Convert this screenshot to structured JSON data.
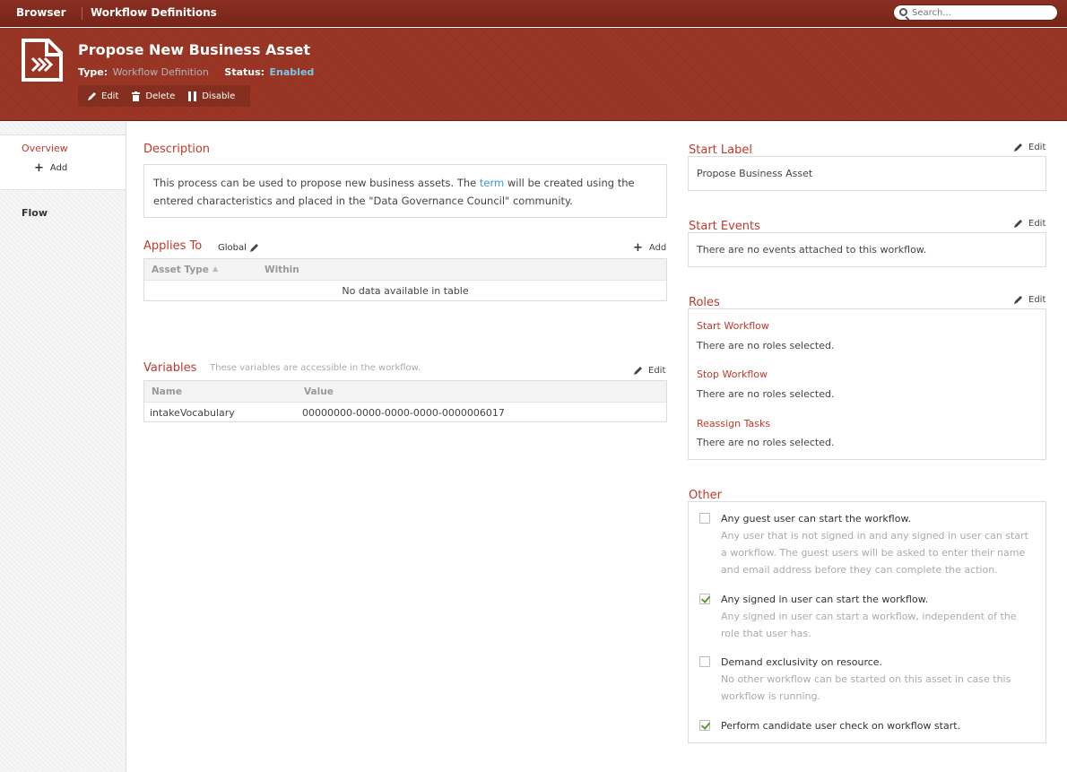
{
  "topbar": {
    "brand": "Browser",
    "crumb": "Workflow Definitions",
    "search_placeholder": "Search..."
  },
  "header": {
    "title": "Propose New Business Asset",
    "type_label": "Type:",
    "type_value": "Workflow Definition",
    "status_label": "Status:",
    "status_value": "Enabled",
    "actions": {
      "edit": "Edit",
      "delete": "Delete",
      "disable": "Disable"
    }
  },
  "sidebar": {
    "overview": "Overview",
    "add": "Add",
    "flow": "Flow"
  },
  "description": {
    "title": "Description",
    "text_before": "This process can be used to propose new business assets. The ",
    "link": "term",
    "text_after": " will be created using the entered characteristics and placed in the \"Data Governance Council\" community."
  },
  "applies_to": {
    "title": "Applies To",
    "scope": "Global",
    "add": "Add",
    "columns": [
      "Asset Type",
      "Within"
    ],
    "empty": "No data available in table"
  },
  "variables": {
    "title": "Variables",
    "note": "These variables are accessible in the workflow.",
    "edit": "Edit",
    "columns": [
      "Name",
      "Value"
    ],
    "rows": [
      {
        "name": "intakeVocabulary",
        "value": "00000000-0000-0000-0000-0000006017"
      }
    ]
  },
  "start_label": {
    "title": "Start Label",
    "edit": "Edit",
    "value": "Propose Business Asset"
  },
  "start_events": {
    "title": "Start Events",
    "edit": "Edit",
    "value": "There are no events attached to this workflow."
  },
  "roles": {
    "title": "Roles",
    "edit": "Edit",
    "items": [
      {
        "title": "Start Workflow",
        "value": "There are no roles selected."
      },
      {
        "title": "Stop Workflow",
        "value": "There are no roles selected."
      },
      {
        "title": "Reassign Tasks",
        "value": "There are no roles selected."
      }
    ]
  },
  "other": {
    "title": "Other",
    "options": [
      {
        "label": "Any guest user can start the workflow.",
        "checked": false,
        "help": "Any user that is not signed in and any signed in user can start a workflow. The guest users will be asked to enter their name and email address before they can complete the action."
      },
      {
        "label": "Any signed in user can start the workflow.",
        "checked": true,
        "help": "Any signed in user can start a workflow, independent of the role that user has."
      },
      {
        "label": "Demand exclusivity on resource.",
        "checked": false,
        "help": "No other workflow can be started on this asset in case this workflow is running."
      },
      {
        "label": "Perform candidate user check on workflow start.",
        "checked": true,
        "help": ""
      }
    ]
  },
  "colors": {
    "brand": "#8a2f23",
    "accent_red": "#c0392b",
    "link_blue": "#3a9ad9",
    "status_blue": "#79c6e8",
    "check_green": "#5a9e2d"
  }
}
